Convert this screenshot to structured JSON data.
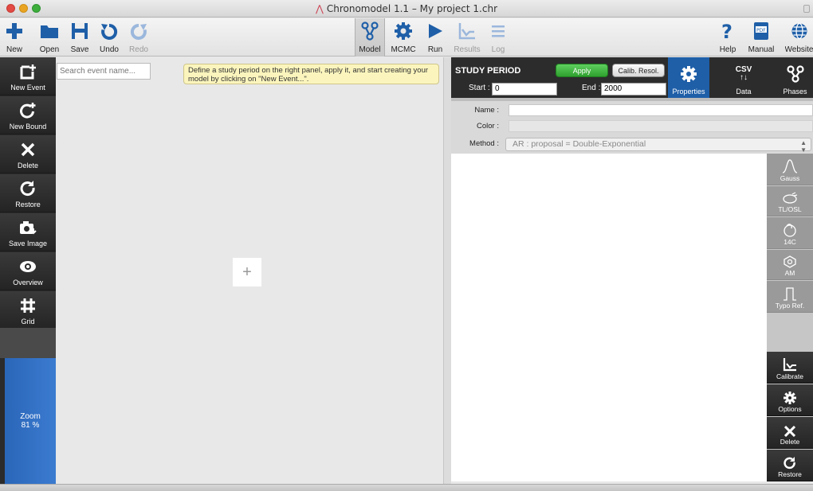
{
  "window": {
    "title": "Chronomodel 1.1 – My project 1.chr"
  },
  "toolbar": {
    "new": "New",
    "open": "Open",
    "save": "Save",
    "undo": "Undo",
    "redo": "Redo",
    "model": "Model",
    "mcmc": "MCMC",
    "run": "Run",
    "results": "Results",
    "log": "Log",
    "help": "Help",
    "manual": "Manual",
    "website": "Website"
  },
  "sidebar": {
    "new_event": "New Event",
    "new_bound": "New Bound",
    "delete": "Delete",
    "restore": "Restore",
    "save_image": "Save Image",
    "overview": "Overview",
    "grid": "Grid",
    "zoom_label": "Zoom",
    "zoom_value": "81 %"
  },
  "canvas": {
    "search_placeholder": "Search event name...",
    "hint": "Define a study period on the right panel, apply it, and start creating your model by clicking on \"New Event...\".",
    "plus": "+"
  },
  "study_period": {
    "title": "STUDY PERIOD",
    "apply": "Apply",
    "calib_resol": "Calib. Resol.",
    "start_label": "Start :",
    "start_value": "0",
    "end_label": "End :",
    "end_value": "2000"
  },
  "panel_tabs": {
    "properties": "Properties",
    "data_csv": "CSV",
    "data": "Data",
    "phases": "Phases"
  },
  "event_form": {
    "name_label": "Name :",
    "color_label": "Color :",
    "method_label": "Method :",
    "method_value": "AR : proposal = Double-Exponential"
  },
  "data_tools": {
    "gauss": "Gauss",
    "tlosl": "TL/OSL",
    "c14": "14C",
    "am": "AM",
    "typo": "Typo Ref.",
    "calibrate": "Calibrate",
    "options": "Options",
    "delete": "Delete",
    "restore": "Restore"
  },
  "colors": {
    "accent_blue": "#1f5fa8",
    "apply_green": "#2ea02e",
    "sidebar_dark": "#2b2b2b",
    "hint_yellow": "#fbf5bd"
  }
}
